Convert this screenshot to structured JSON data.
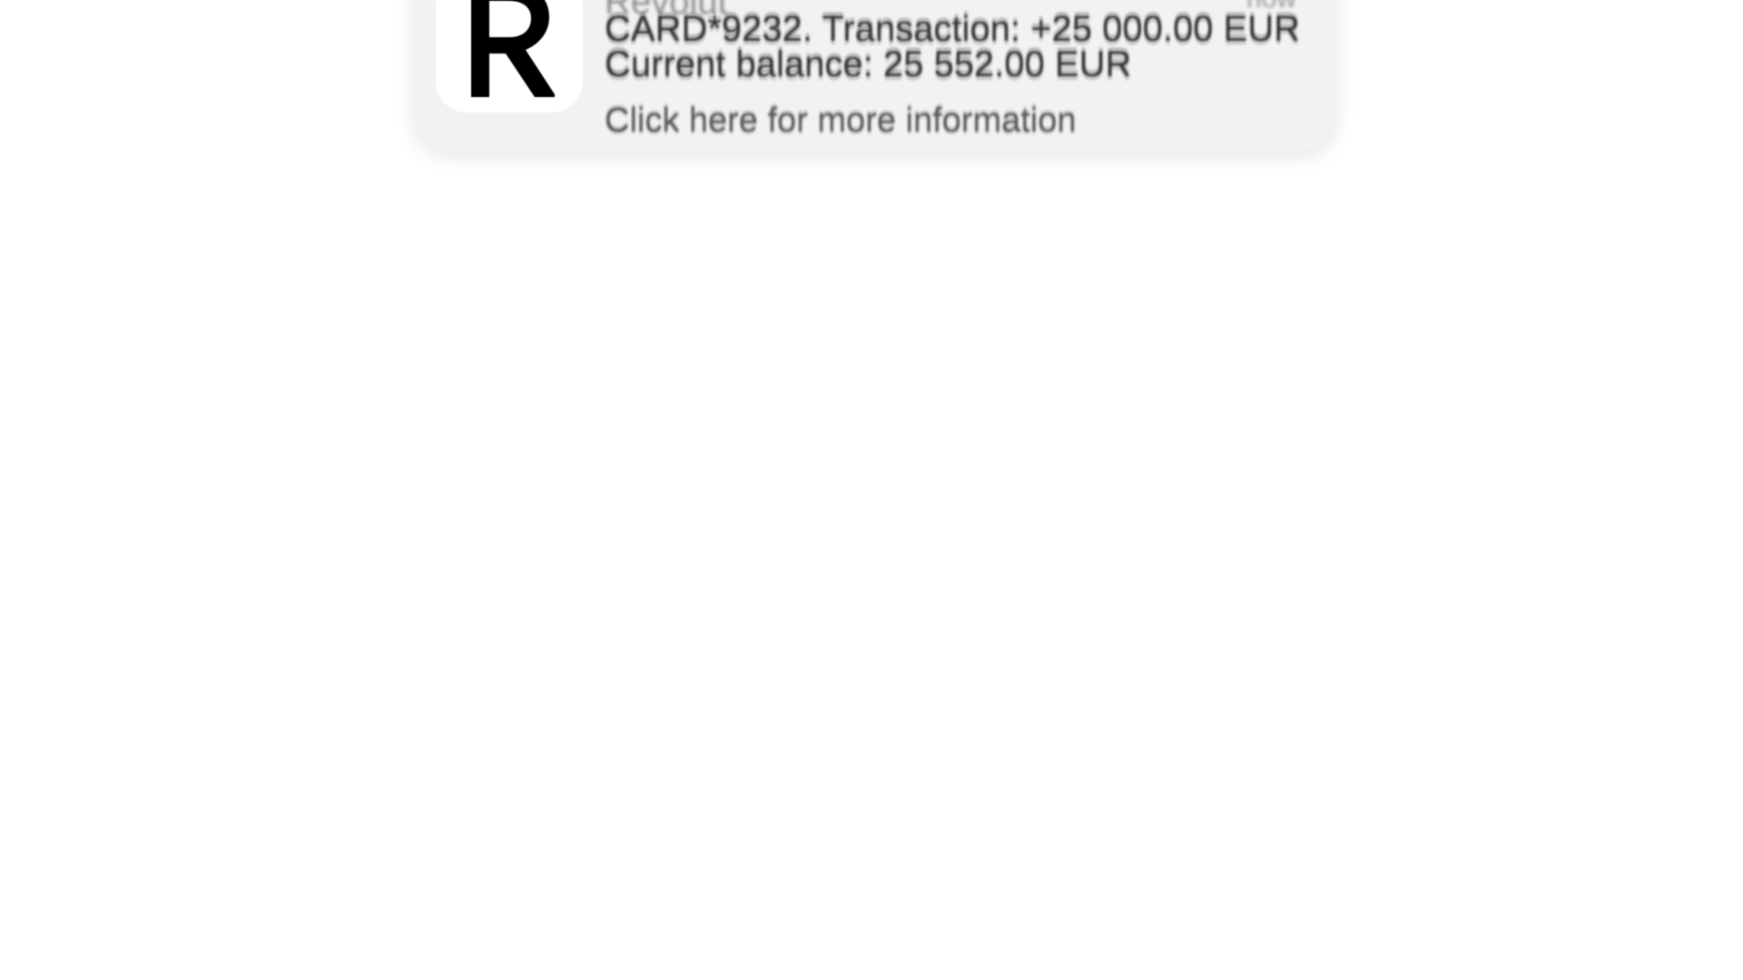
{
  "notification": {
    "app_name": "Revolut",
    "timestamp": "now",
    "icon": "revolut-r-logo",
    "message_line_1": "CARD*9232. Transaction: +25 000.00 EUR",
    "message_line_2": "Current balance: 25 552.00 EUR",
    "more_info_link": "Click here for more information"
  },
  "colors": {
    "background": "#ffffff",
    "notification_bg": "#f2f2f2",
    "icon_bg": "#ffffff",
    "logo": "#000000"
  }
}
